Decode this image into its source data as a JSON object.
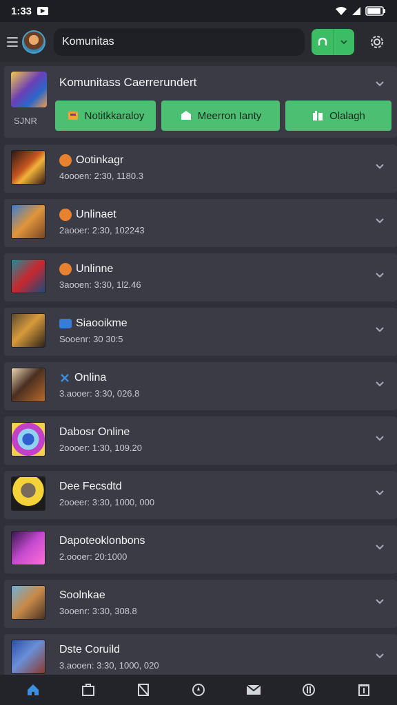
{
  "status": {
    "time": "1:33"
  },
  "header": {
    "search_value": "Komunitas"
  },
  "featured": {
    "title": "Komunitass Caerrerundert",
    "sub": "SJNR",
    "actions": [
      {
        "label": "Notitkkaraloy",
        "icon": "box-icon"
      },
      {
        "label": "Meerron Ianty",
        "icon": "shield-icon"
      },
      {
        "label": "Olalagh",
        "icon": "gift-icon"
      }
    ]
  },
  "items": [
    {
      "name": "Ootinkagr",
      "sub": "4oooen: 2:30, 1180.3",
      "badge": "orange"
    },
    {
      "name": "Unlinaet",
      "sub": "2aooer: 2:30, 102243",
      "badge": "orange"
    },
    {
      "name": "Unlinne",
      "sub": "3aooen: 3:30, 1l2.46",
      "badge": "orange"
    },
    {
      "name": "Siaooikme",
      "sub": "Sooenr: 30 30:5",
      "badge": "blue"
    },
    {
      "name": "Onlina",
      "sub": "3.aooer: 3:30, 026.8",
      "badge": "x"
    },
    {
      "name": "Dabosr Online",
      "sub": "2oooer: 1:30, 109.20",
      "badge": ""
    },
    {
      "name": "Dee Fecsdtd",
      "sub": "2ooeer: 3:30, 1000, 000",
      "badge": ""
    },
    {
      "name": "Dapoteoklonbons",
      "sub": "2.oooer: 20:1000",
      "badge": ""
    },
    {
      "name": "Soolnkae",
      "sub": "3ooenr: 3:30, 308.8",
      "badge": ""
    },
    {
      "name": "Dste Coruild",
      "sub": "3.aooen: 3:30, 1000, 020",
      "badge": ""
    }
  ],
  "nav": [
    "home-icon",
    "folder-icon",
    "bookmark-icon",
    "compass-icon",
    "mail-icon",
    "circle-icon",
    "clipboard-icon"
  ],
  "colors": {
    "accent": "#3dbd63",
    "card": "#3a3b44",
    "bg": "#2f3038",
    "nav_active": "#3b8fe0"
  }
}
